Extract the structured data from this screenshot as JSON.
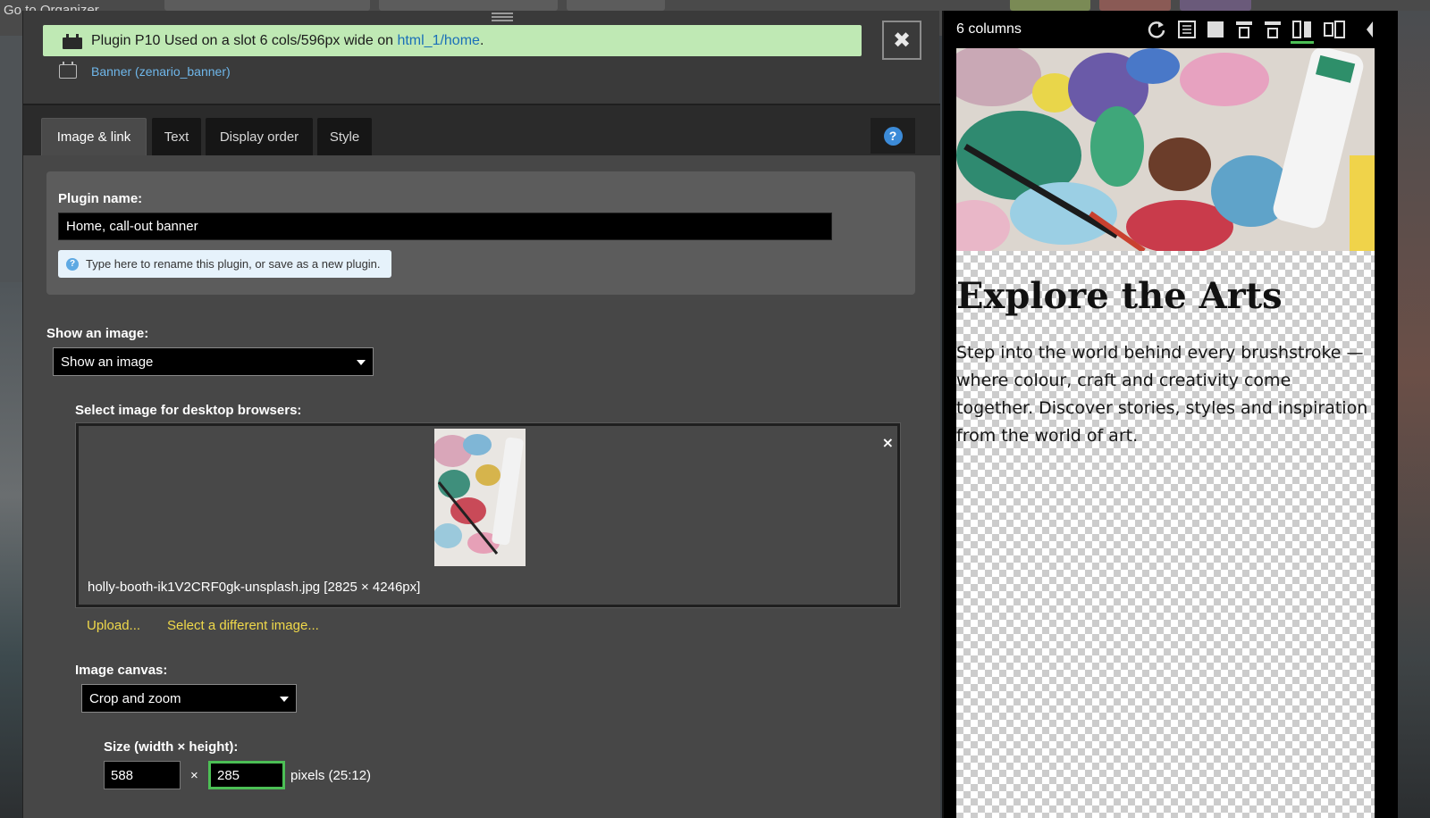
{
  "background": {
    "breadcrumb": "Go to Organizer"
  },
  "notice": {
    "prefix": "Plugin P10 Used on a slot 6 cols/596px wide on ",
    "link": "html_1/home",
    "suffix": "."
  },
  "module": {
    "label": "Banner (zenario_banner)"
  },
  "tabs": [
    {
      "label": "Image & link",
      "active": true
    },
    {
      "label": "Text",
      "active": false
    },
    {
      "label": "Display order",
      "active": false
    },
    {
      "label": "Style",
      "active": false
    }
  ],
  "help_label": "?",
  "form": {
    "plugin_name_label": "Plugin name:",
    "plugin_name_value": "Home, call-out banner",
    "plugin_name_tip": "Type here to rename this plugin, or save as a new plugin.",
    "show_image_label": "Show an image:",
    "show_image_value": "Show an image",
    "select_image_label": "Select image for desktop browsers:",
    "image_file": "holly-booth-ik1V2CRF0gk-unsplash.jpg [2825 × 4246px]",
    "remove_label": "×",
    "upload_label": "Upload...",
    "select_different_label": "Select a different image...",
    "canvas_label": "Image canvas:",
    "canvas_value": "Crop and zoom",
    "size_label": "Size (width × height):",
    "width_value": "588",
    "times": "×",
    "height_value": "285",
    "size_suffix": "pixels (25:12)"
  },
  "close_label": "✖",
  "preview": {
    "title": "6 columns",
    "icons": [
      "refresh-icon",
      "document-icon",
      "square-icon",
      "layout-top-icon",
      "layout-middle-icon",
      "layout-columns-icon",
      "split-view-icon",
      "collapse-icon"
    ],
    "banner_title": "Explore the Arts",
    "banner_text": "Step into the world behind every brushstroke — where colour, craft and creativity come together. Discover stories, styles and inspiration from the world of art."
  },
  "colors": {
    "notice_bg": "#bfe9b4",
    "link_blue": "#1a6fb8",
    "accent_yellow": "#f0d94a",
    "active_field_border": "#4cbf55",
    "help_blue": "#3c8bd8"
  }
}
